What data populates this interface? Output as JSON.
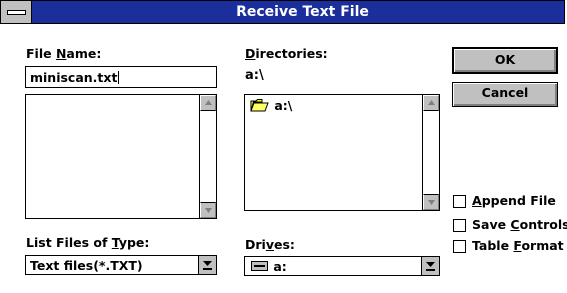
{
  "window": {
    "title": "Receive Text File"
  },
  "file_name": {
    "label_pre": "File ",
    "label_key": "N",
    "label_post": "ame:",
    "value": "miniscan.txt",
    "files": []
  },
  "directories": {
    "label_key": "D",
    "label_post": "irectories:",
    "current_path": "a:\\",
    "items": [
      {
        "label": "a:\\",
        "icon": "open-folder-icon"
      }
    ]
  },
  "file_type": {
    "label_pre": "List Files of ",
    "label_key": "T",
    "label_post": "ype:",
    "value": "Text files(*.TXT)"
  },
  "drives": {
    "label_pre": "Dri",
    "label_key": "v",
    "label_post": "es:",
    "value": "a:",
    "icon": "floppy-drive-icon"
  },
  "buttons": {
    "ok": "OK",
    "cancel": "Cancel"
  },
  "options": {
    "append": {
      "key": "A",
      "rest": "ppend File",
      "checked": false
    },
    "save_controls": {
      "pre": "Save ",
      "key": "C",
      "rest": "ontrols",
      "checked": false
    },
    "table_format": {
      "pre": "Table ",
      "key": "F",
      "rest": "ormat",
      "checked": false
    }
  },
  "colors": {
    "titlebar": "#1a2f9c",
    "button_face": "#c0c0c0",
    "window": "#ffffff"
  }
}
